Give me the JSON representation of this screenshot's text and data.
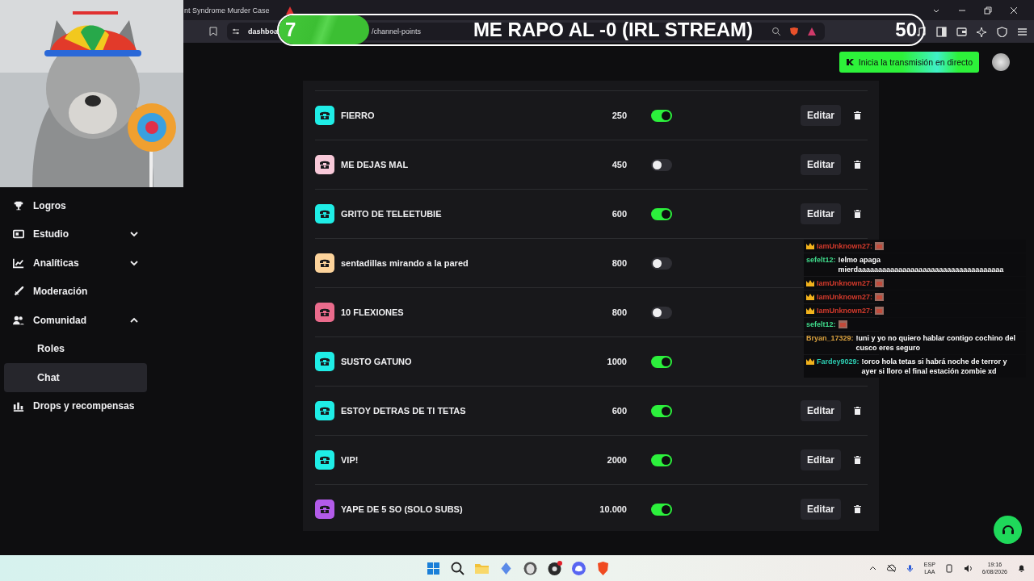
{
  "browser": {
    "tab_title": "nt Syndrome Murder Case",
    "url_start": "dashboa",
    "url_end": "/channel-points"
  },
  "stream_goal": {
    "current": "7",
    "title": "ME RAPO AL -0 (IRL STREAM)",
    "target": "50",
    "level": 0.14
  },
  "header": {
    "go_live_button": "Inicia la transmisión en directo"
  },
  "sidebar": {
    "items": [
      {
        "label": "Logros",
        "selected": false
      },
      {
        "label": "Estudio",
        "selected": false,
        "expanded": false
      },
      {
        "label": "Analíticas",
        "selected": false,
        "expanded": false
      },
      {
        "label": "Moderación",
        "selected": false
      },
      {
        "label": "Comunidad",
        "selected": false,
        "expanded": true,
        "children": [
          {
            "label": "Roles",
            "selected": false
          },
          {
            "label": "Chat",
            "selected": true
          }
        ]
      },
      {
        "label": "Drops y recompensas",
        "selected": false
      }
    ]
  },
  "rewards": [
    {
      "title": "FIERRO",
      "cost": "250",
      "enabled": true,
      "color": "#1fede6",
      "edit": "Editar"
    },
    {
      "title": "ME DEJAS MAL",
      "cost": "450",
      "enabled": false,
      "color": "#f8c9d9",
      "edit": "Editar"
    },
    {
      "title": "GRITO DE TELEETUBIE",
      "cost": "600",
      "enabled": true,
      "color": "#1fede6",
      "edit": "Editar"
    },
    {
      "title": "sentadillas mirando a la pared",
      "cost": "800",
      "enabled": false,
      "color": "#fcd39b"
    },
    {
      "title": "10 FLEXIONES",
      "cost": "800",
      "enabled": false,
      "color": "#ea6b8c"
    },
    {
      "title": "SUSTO GATUNO",
      "cost": "1000",
      "enabled": true,
      "color": "#1fede6"
    },
    {
      "title": "ESTOY DETRAS DE TI TETAS",
      "cost": "600",
      "enabled": true,
      "color": "#1fede6",
      "edit": "Editar"
    },
    {
      "title": "VIP!",
      "cost": "2000",
      "enabled": true,
      "color": "#1fede6",
      "edit": "Editar"
    },
    {
      "title": "YAPE DE 5 SO (SOLO SUBS)",
      "cost": "10.000",
      "enabled": true,
      "color": "#b25be9",
      "edit": "Editar"
    }
  ],
  "chat_overlay": {
    "messages": [
      {
        "user": "IamUnknown27:",
        "color": "#d43a2c",
        "crown": true,
        "emote": true
      },
      {
        "user": "sefelt12:",
        "text": "!elmo apaga mierdaaaaaaaaaaaaaaaaaaaaaaaaaaaaaaaaaaaa",
        "color": "#3fd98a",
        "crown": false,
        "emote": false
      },
      {
        "user": "IamUnknown27:",
        "color": "#d43a2c",
        "crown": true,
        "emote": true
      },
      {
        "user": "IamUnknown27:",
        "color": "#d43a2c",
        "crown": true,
        "emote": true
      },
      {
        "user": "IamUnknown27:",
        "color": "#d43a2c",
        "crown": true,
        "emote": true
      },
      {
        "user": "sefelt12:",
        "color": "#3fd98a",
        "crown": false,
        "emote": true
      },
      {
        "user": "Bryan_17329:",
        "text": "!uni y yo no quiero hablar contigo cochino del cusco eres seguro",
        "color": "#d9a13f",
        "crown": false,
        "emote": false
      },
      {
        "user": "Fardey9029:",
        "text": "!orco hola tetas si habrá noche de terror y ayer si lloro el final estación zombie xd",
        "color": "#2ccbb0",
        "crown": true,
        "emote": false
      }
    ]
  },
  "taskbar": {
    "language": "ESP",
    "layout": "LAA",
    "time": "19:16",
    "date": "6/08/2026"
  }
}
